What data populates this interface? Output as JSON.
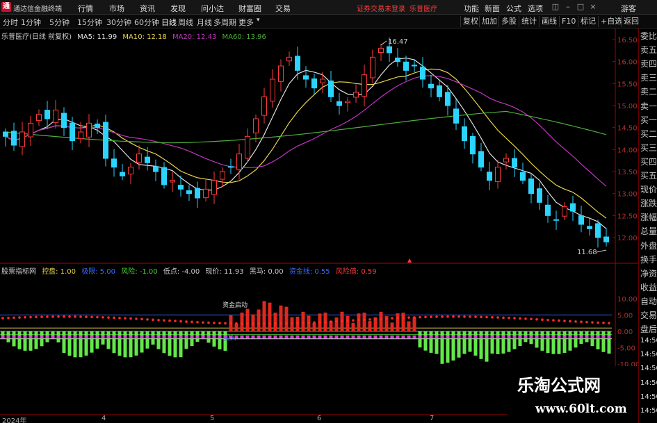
{
  "app": {
    "name": "通达信金融终端",
    "menus": [
      "行情",
      "市场",
      "资讯",
      "发现",
      "问小达",
      "财富圈",
      "交易"
    ],
    "notice": "证券交易未登录",
    "stock_title": "乐普医疗",
    "right_menus": [
      "功能",
      "新面",
      "公式",
      "选项"
    ],
    "guest": "游客"
  },
  "periods": [
    "分时",
    "1分钟",
    "5分钟",
    "15分钟",
    "30分钟",
    "60分钟",
    "日线",
    "周线",
    "月线",
    "多周期",
    "更多"
  ],
  "active_period": "日线",
  "toolbar": [
    "复权",
    "加加",
    "多股",
    "统计",
    "画线",
    "F10",
    "标记",
    "+自选",
    "返回"
  ],
  "main_legend": {
    "title": "乐普医疗(日线 前复权)",
    "items": [
      {
        "label": "MA5: 11.99",
        "color": "#e0e0e0"
      },
      {
        "label": "MA10: 12.18",
        "color": "#e8d44d"
      },
      {
        "label": "MA20: 12.43",
        "color": "#c036c0"
      },
      {
        "label": "MA60: 13.96",
        "color": "#4caf3a"
      }
    ]
  },
  "sub_legend": {
    "title": "股票指标网",
    "items": [
      {
        "label": "控盘: 1.00",
        "color": "#e8d44d"
      },
      {
        "label": "极限: 5.00",
        "color": "#3a6bff"
      },
      {
        "label": "风险: -1.00",
        "color": "#4cd137"
      },
      {
        "label": "低点: -4.00",
        "color": "#cccccc"
      },
      {
        "label": "现价: 11.93",
        "color": "#cccccc"
      },
      {
        "label": "黑马: 0.00",
        "color": "#cccccc"
      },
      {
        "label": "资金线: 0.55",
        "color": "#3a6bff"
      },
      {
        "label": "风险值: 0.59",
        "color": "#ff3b3b"
      }
    ]
  },
  "right_panel": [
    "委比",
    "卖五",
    "卖四",
    "卖三",
    "卖二",
    "卖一",
    "买一",
    "买二",
    "买三",
    "买四",
    "买五",
    "现价",
    "涨跌",
    "涨幅",
    "总量",
    "外盘",
    "换手",
    "净资",
    "收益",
    "自动",
    "交易",
    "盘后",
    "14:50",
    "14:50",
    "14:50",
    "14:50",
    "14:50",
    "14:50"
  ],
  "annotations": {
    "high": "16.47",
    "low": "11.68",
    "label_main": "资金启动",
    "label_sub": "买入"
  },
  "dates": [
    "2024年",
    "4",
    "5",
    "6",
    "7"
  ],
  "watermark": {
    "line1": "乐淘公式网",
    "line2": "www.60lt.com"
  },
  "colors": {
    "up": "#ff3b3b",
    "down": "#2ad4ff",
    "ma5": "#e0e0e0",
    "ma10": "#e8d44d",
    "ma20": "#c036c0",
    "ma60": "#4caf3a",
    "axis": "#b00000"
  },
  "chart_data": {
    "type": "candlestick",
    "price_axis": [
      16.5,
      16.0,
      15.5,
      15.0,
      14.5,
      14.0,
      13.5,
      13.0,
      12.5,
      12.0
    ],
    "sub_axis": [
      10.0,
      5.0,
      0.0,
      -5.0,
      -10.0
    ],
    "closes": [
      14.3,
      14.1,
      14.4,
      14.6,
      14.8,
      14.7,
      14.9,
      14.5,
      14.2,
      14.4,
      14.6,
      14.5,
      13.8,
      13.6,
      13.4,
      13.6,
      13.9,
      13.7,
      13.5,
      13.2,
      13.3,
      13.1,
      13.0,
      12.9,
      13.1,
      13.3,
      13.5,
      13.6,
      13.9,
      14.3,
      14.7,
      15.2,
      15.6,
      15.9,
      16.1,
      15.8,
      15.6,
      15.4,
      15.6,
      15.2,
      15.0,
      15.1,
      15.3,
      15.7,
      16.1,
      16.3,
      16.2,
      16.0,
      15.8,
      15.9,
      15.6,
      15.4,
      15.2,
      15.0,
      14.6,
      14.2,
      13.9,
      13.6,
      13.3,
      13.6,
      13.8,
      13.6,
      13.3,
      13.0,
      12.8,
      12.5,
      12.4,
      12.7,
      12.6,
      12.3,
      12.2,
      12.0,
      11.9
    ]
  }
}
